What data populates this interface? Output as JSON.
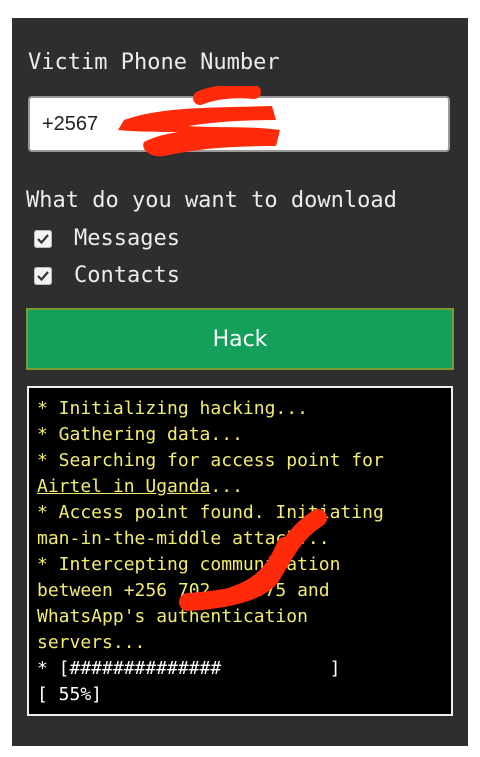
{
  "form": {
    "phone_label": "Victim Phone Number",
    "phone_value": "+2567",
    "download_label": "What do you want to download",
    "options": [
      {
        "label": "Messages",
        "checked": true
      },
      {
        "label": "Contacts",
        "checked": true
      }
    ],
    "hack_button_label": "Hack"
  },
  "terminal": {
    "line1": "* Initializing hacking...",
    "line2": "* Gathering data...",
    "line3": "* Searching for access point for",
    "line4_link": "Airtel in Uganda",
    "line4_suffix": "...",
    "line5": "* Access point found. Initiating",
    "line6": "man-in-the-middle attack...",
    "line7": "* Intercepting communication",
    "line8": "between +256 702    375 and",
    "line9": "WhatsApp's authentication",
    "line10": "servers...",
    "progress_bar": "* [##############          ]",
    "progress_percent_text": "[ 55%]",
    "progress_value": 0.55
  },
  "colors": {
    "panel_bg": "#2e2e2e",
    "button_bg": "#12a05a",
    "terminal_text": "#f2ec70",
    "redaction": "#ff2a0a"
  },
  "icons": {
    "checkbox": "check-icon",
    "redaction": "red-scribble"
  }
}
